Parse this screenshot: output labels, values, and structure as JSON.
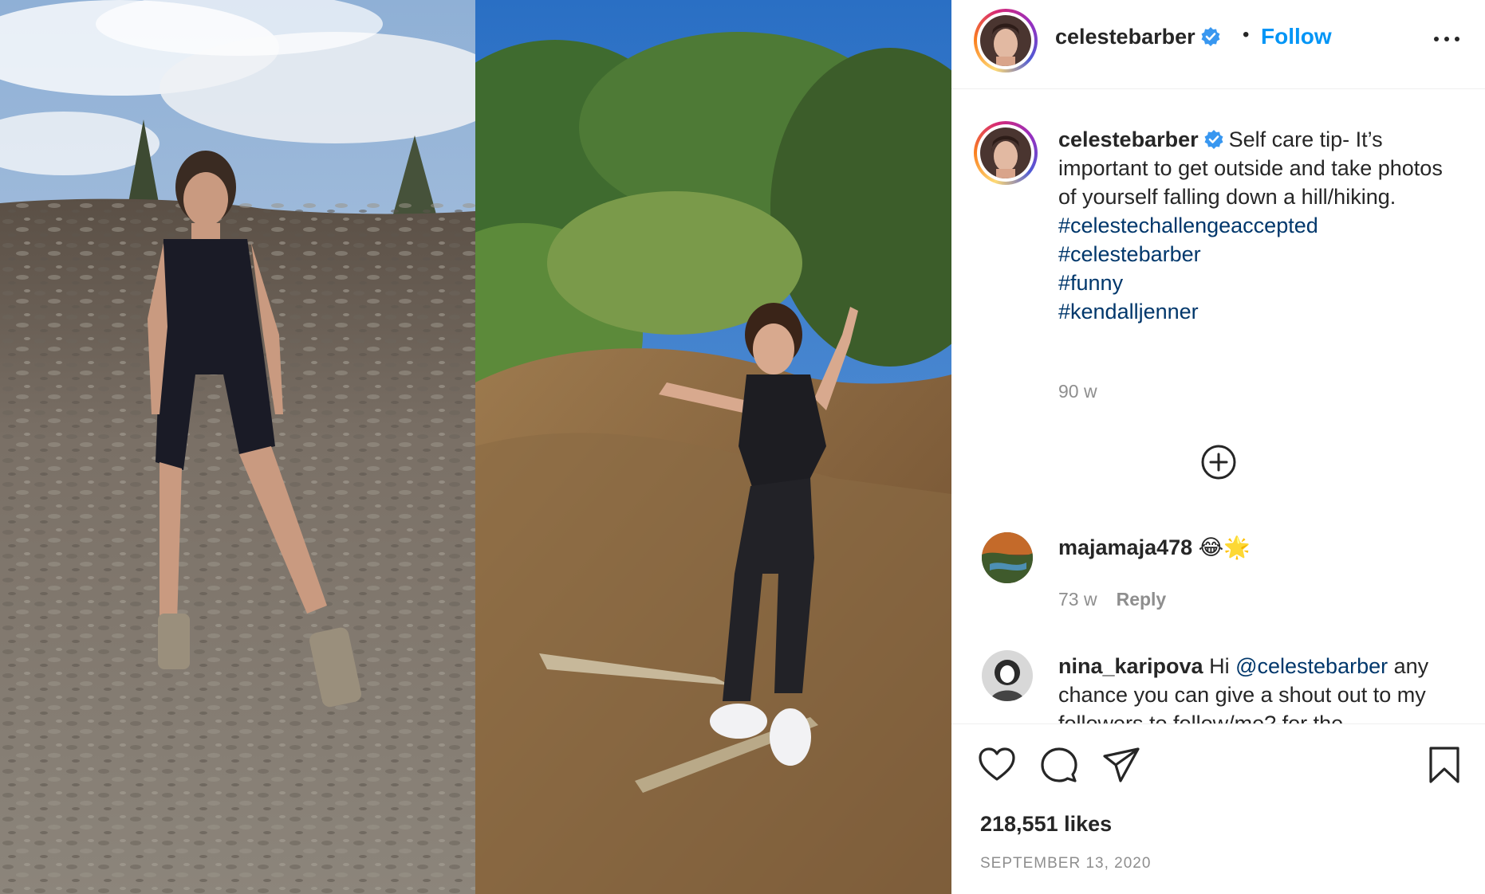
{
  "post": {
    "username": "celestebarber",
    "follow_label": "Follow",
    "dot": "•",
    "verified_icon": "verified-badge-icon",
    "more_icon": "more-options-icon"
  },
  "caption": {
    "username": "celestebarber",
    "text": "Self care tip- It’s important to get outside and take photos of yourself falling down a hill/hiking.",
    "hashtags": [
      "#celestechallengeaccepted",
      "#celestebarber",
      "#funny",
      "#kendalljenner"
    ],
    "time": "90 w"
  },
  "comments": [
    {
      "username": "majamaja478",
      "text": "😂🌟",
      "time": "73 w",
      "reply_label": "Reply"
    },
    {
      "username": "nina_karipova",
      "text_before": "Hi ",
      "mention": "@celestebarber",
      "text_after": " any chance you can give a shout out to my followers to follow/me? for the"
    }
  ],
  "footer": {
    "likes": "218,551 likes",
    "date": "SEPTEMBER 13, 2020"
  },
  "colors": {
    "accent": "#0095f6",
    "hashtag": "#00376b",
    "secondary_text": "#8e8e8e",
    "verified": "#3897f0"
  }
}
